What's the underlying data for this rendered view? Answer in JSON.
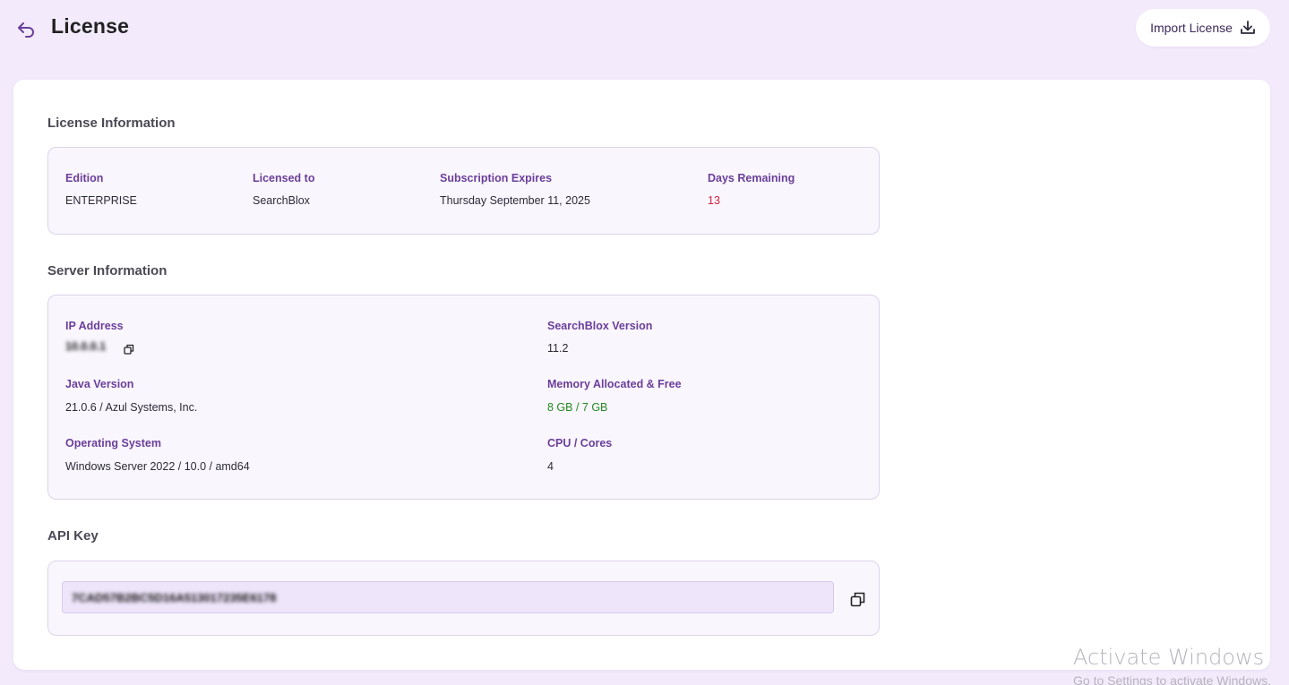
{
  "header": {
    "title": "License",
    "import_label": "Import License"
  },
  "license_info": {
    "section_title": "License Information",
    "fields": [
      {
        "label": "Edition",
        "value": "ENTERPRISE"
      },
      {
        "label": "Licensed to",
        "value": "SearchBlox"
      },
      {
        "label": "Subscription Expires",
        "value": "Thursday September 11, 2025"
      },
      {
        "label": "Days Remaining",
        "value": "13"
      }
    ]
  },
  "server_info": {
    "section_title": "Server Information",
    "ip_label": "IP Address",
    "ip_value": "10.0.0.1",
    "version_label": "SearchBlox Version",
    "version_value": "11.2",
    "java_label": "Java Version",
    "java_value": "21.0.6 / Azul Systems, Inc.",
    "memory_label": "Memory Allocated & Free",
    "memory_value": "8 GB / 7 GB",
    "os_label": "Operating System",
    "os_value": "Windows Server 2022 / 10.0 / amd64",
    "cpu_label": "CPU / Cores",
    "cpu_value": "4"
  },
  "api_key": {
    "section_title": "API Key",
    "value": "7CAD57B2BC5D16A513017235E6178"
  },
  "watermark": {
    "line1": "Activate Windows",
    "line2": "Go to Settings to activate Windows."
  },
  "colors": {
    "accent": "#6a3f9a",
    "days_remaining": "#d0223a",
    "memory": "#1f8a1f",
    "background": "#f3ebfc"
  },
  "icons": {
    "back": "undo-arrow-icon",
    "import": "download-icon",
    "copy": "copy-icon"
  }
}
